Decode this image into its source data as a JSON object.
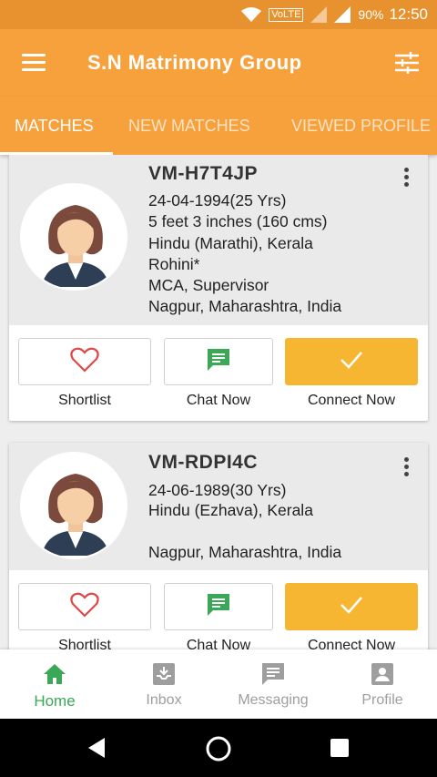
{
  "status_bar": {
    "volte": "VoLTE",
    "battery": "90%",
    "time": "12:50"
  },
  "app_bar": {
    "title": "S.N Matrimony Group"
  },
  "tabs": [
    {
      "label": "MATCHES"
    },
    {
      "label": "NEW MATCHES"
    },
    {
      "label": "VIEWED PROFILE"
    }
  ],
  "profiles": [
    {
      "id": "VM-H7T4JP",
      "details": [
        "24-04-1994(25 Yrs)",
        "5 feet 3 inches (160 cms)",
        "Hindu (Marathi), Kerala",
        "Rohini*",
        "MCA, Supervisor",
        "Nagpur, Maharashtra,  India"
      ],
      "actions": {
        "shortlist": "Shortlist",
        "chat": "Chat Now",
        "connect": "Connect Now"
      }
    },
    {
      "id": "VM-RDPI4C",
      "details": [
        "24-06-1989(30 Yrs)",
        "Hindu (Ezhava), Kerala",
        "",
        "Nagpur, Maharashtra,  India"
      ],
      "actions": {
        "shortlist": "Shortlist",
        "chat": "Chat Now",
        "connect": "Connect Now"
      }
    }
  ],
  "bottom_nav": [
    {
      "label": "Home",
      "icon": "home-icon"
    },
    {
      "label": "Inbox",
      "icon": "inbox-icon"
    },
    {
      "label": "Messaging",
      "icon": "message-icon"
    },
    {
      "label": "Profile",
      "icon": "profile-icon"
    }
  ],
  "colors": {
    "status_bar": "#e8922f",
    "app_bar": "#f7a13d",
    "connect_button": "#f7b632",
    "chat_icon": "#3aa856",
    "heart_icon": "#e04848",
    "active_nav": "#3aa856"
  }
}
